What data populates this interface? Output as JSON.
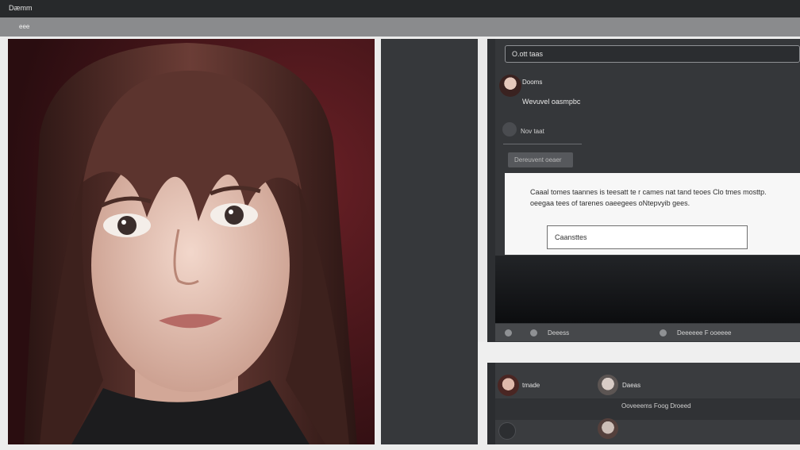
{
  "window": {
    "title": "Dæmm"
  },
  "toolbar": {
    "tab_label": "eee"
  },
  "search": {
    "value": "O.ott taas"
  },
  "chat": {
    "header": {
      "name": "Dooms",
      "subtitle": "Wevuvel oasmpbc"
    },
    "new_item": "Nov taat",
    "button_label": "Dereuvent oeaer"
  },
  "dialog": {
    "message": "Caaal tomes taannes is teesatt te r cames nat tand teoes Clo tmes mosttp.",
    "message_line2": "oeegaa tees of tarenes oaeegees oNtepvyib gees.",
    "field_value": "Caansttes"
  },
  "statusbar": {
    "left_label": "Deeess",
    "right_label": "Deeeeee F ooeeee"
  },
  "lower": {
    "item1": "tmade",
    "item2": "Daeas",
    "footer": "Ooveeems Foog Droeed"
  },
  "colors": {
    "titlebar": "#27292b",
    "toolbar": "#8a8b8d",
    "panel": "#35373a",
    "dialog": "#f7f7f7"
  }
}
